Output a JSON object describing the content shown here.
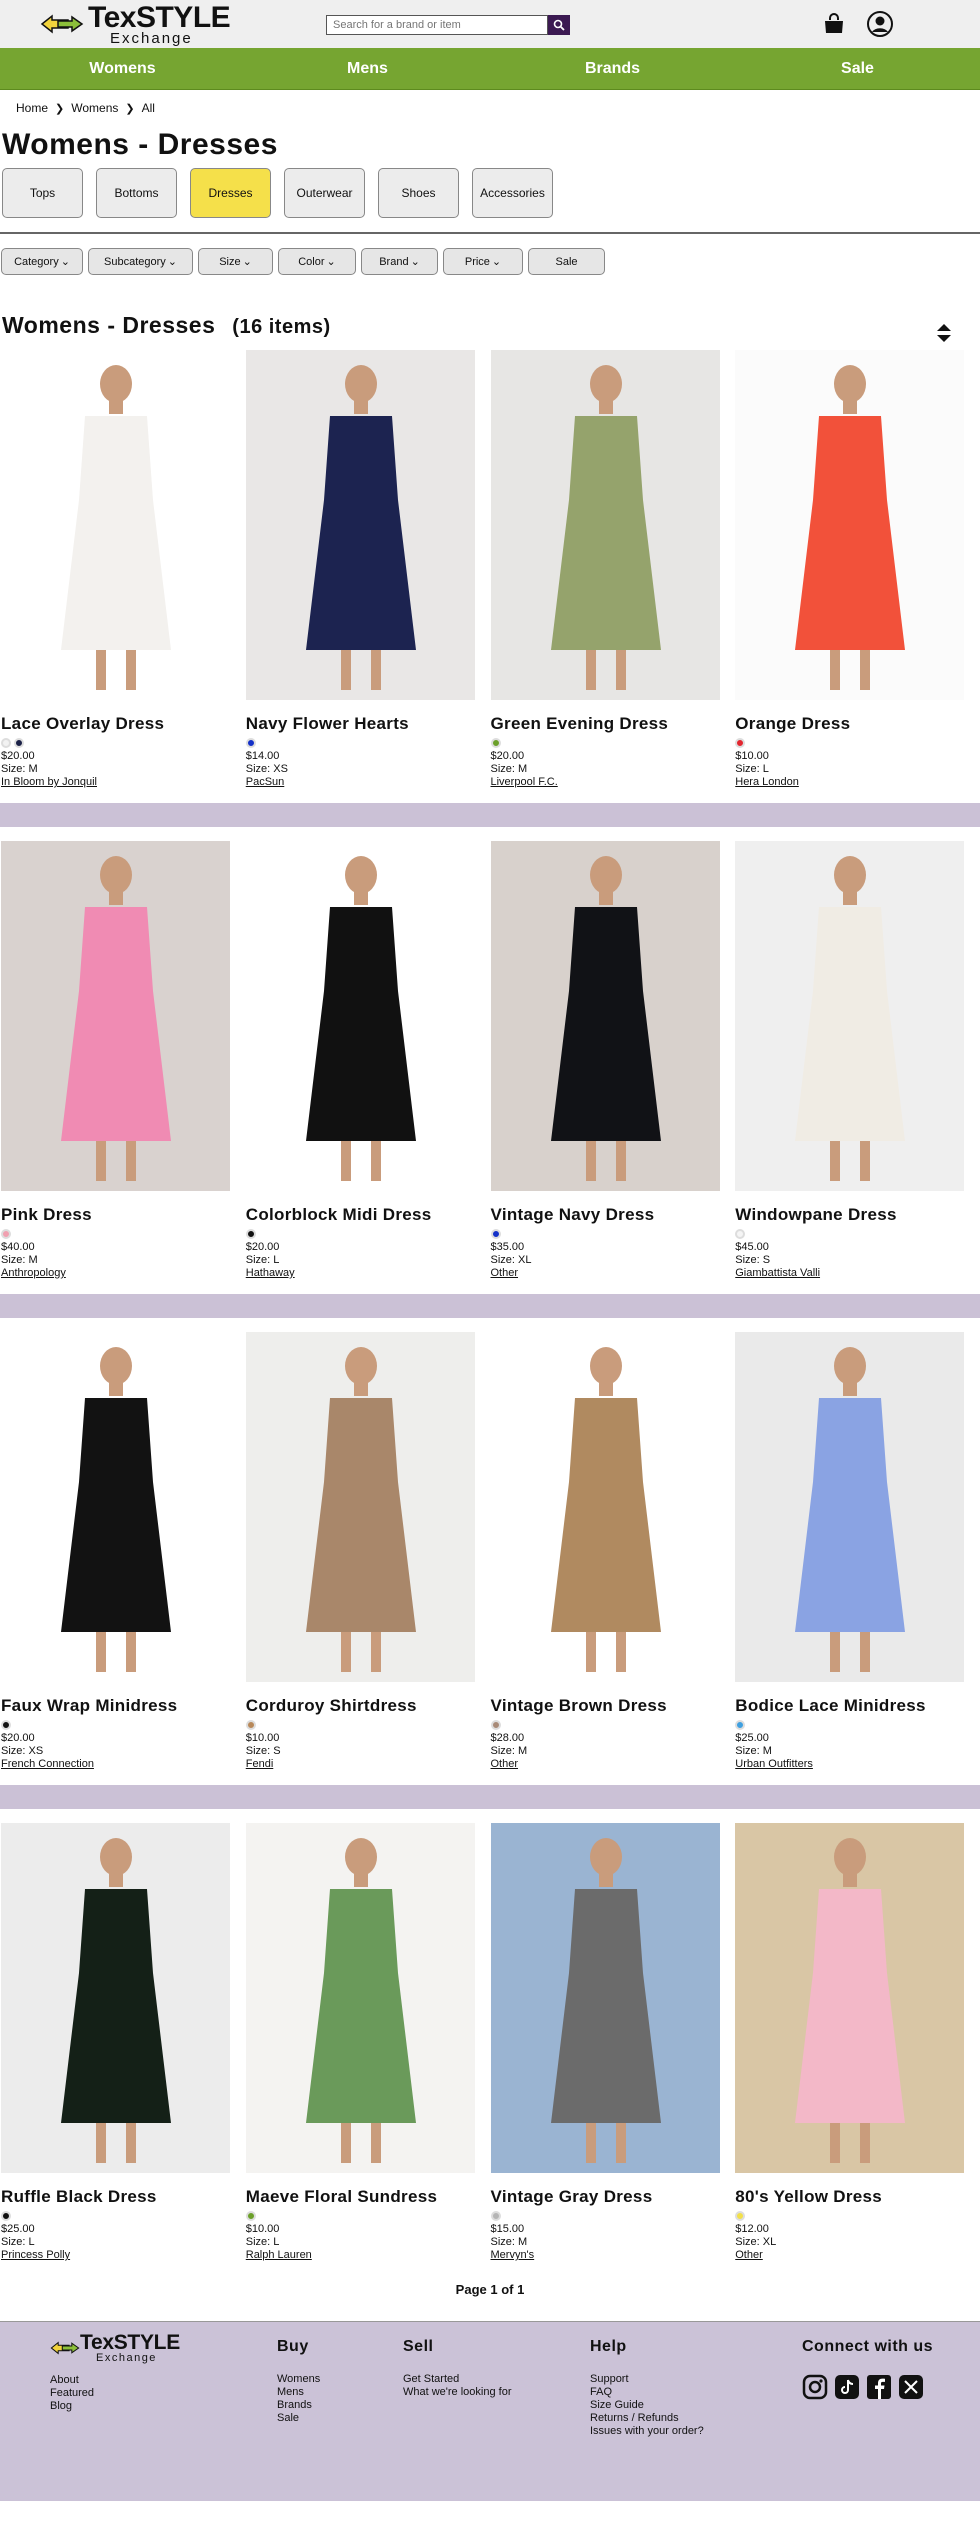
{
  "header": {
    "logo_line1": "TexSTYLE",
    "logo_line2": "Exchange",
    "search_placeholder": "Search for a brand or item"
  },
  "nav": [
    "Womens",
    "Mens",
    "Brands",
    "Sale"
  ],
  "breadcrumb": [
    "Home",
    "Womens",
    "All"
  ],
  "page_title": "Womens - Dresses",
  "categories": [
    "Tops",
    "Bottoms",
    "Dresses",
    "Outerwear",
    "Shoes",
    "Accessories"
  ],
  "active_category": "Dresses",
  "filters": [
    "Category",
    "Subcategory",
    "Size",
    "Color",
    "Brand",
    "Price",
    "Sale"
  ],
  "list": {
    "title": "Womens - Dresses",
    "count": "(16 items)"
  },
  "products": [
    {
      "name": "Lace Overlay Dress",
      "price": "$20.00",
      "size": "Size: M",
      "brand": "In Bloom by Jonquil",
      "swatches": [
        "#f2f2f2",
        "#1b2147"
      ],
      "image_colors": [
        "#ffffff",
        "#f3f1ee"
      ]
    },
    {
      "name": "Navy Flower Hearts",
      "price": "$14.00",
      "size": "Size: XS",
      "brand": "PacSun",
      "swatches": [
        "#1330c8"
      ],
      "image_colors": [
        "#e9e7e6",
        "#1c2350"
      ]
    },
    {
      "name": "Green Evening Dress",
      "price": "$20.00",
      "size": "Size: M",
      "brand": "Liverpool F.C.",
      "swatches": [
        "#6ca02a"
      ],
      "image_colors": [
        "#e7e6e4",
        "#95a36c"
      ]
    },
    {
      "name": "Orange Dress",
      "price": "$10.00",
      "size": "Size: L",
      "brand": "Hera London",
      "swatches": [
        "#e3262f"
      ],
      "image_colors": [
        "#fbfbfb",
        "#f2513a"
      ]
    },
    {
      "name": "Pink Dress",
      "price": "$40.00",
      "size": "Size: M",
      "brand": "Anthropology",
      "swatches": [
        "#f0a0b0"
      ],
      "image_colors": [
        "#d9d2cf",
        "#f08bb3"
      ]
    },
    {
      "name": "Colorblock Midi Dress",
      "price": "$20.00",
      "size": "Size: L",
      "brand": "Hathaway",
      "swatches": [
        "#111111"
      ],
      "image_colors": [
        "#ffffff",
        "#111111"
      ]
    },
    {
      "name": "Vintage Navy Dress",
      "price": "$35.00",
      "size": "Size: XL",
      "brand": "Other",
      "swatches": [
        "#1330c8"
      ],
      "image_colors": [
        "#d8d1cc",
        "#111216"
      ]
    },
    {
      "name": "Windowpane Dress",
      "price": "$45.00",
      "size": "Size: S",
      "brand": "Giambattista Valli",
      "swatches": [
        "#f5f5f5"
      ],
      "image_colors": [
        "#efefef",
        "#f0ece4"
      ]
    },
    {
      "name": "Faux Wrap Minidress",
      "price": "$20.00",
      "size": "Size: XS",
      "brand": "French Connection",
      "swatches": [
        "#111111"
      ],
      "image_colors": [
        "#ffffff",
        "#121212"
      ]
    },
    {
      "name": "Corduroy Shirtdress",
      "price": "$10.00",
      "size": "Size: S",
      "brand": "Fendi",
      "swatches": [
        "#b8895a"
      ],
      "image_colors": [
        "#eeeeec",
        "#a9876a"
      ]
    },
    {
      "name": "Vintage Brown Dress",
      "price": "$28.00",
      "size": "Size: M",
      "brand": "Other",
      "swatches": [
        "#a88a77"
      ],
      "image_colors": [
        "#ffffff",
        "#b08a60"
      ]
    },
    {
      "name": "Bodice Lace Minidress",
      "price": "$25.00",
      "size": "Size: M",
      "brand": "Urban Outfitters",
      "swatches": [
        "#3fa0e0"
      ],
      "image_colors": [
        "#eaeaea",
        "#8aa3e3"
      ]
    },
    {
      "name": "Ruffle Black Dress",
      "price": "$25.00",
      "size": "Size: L",
      "brand": "Princess Polly",
      "swatches": [
        "#111111"
      ],
      "image_colors": [
        "#ececec",
        "#142017"
      ]
    },
    {
      "name": "Maeve Floral Sundress",
      "price": "$10.00",
      "size": "Size: L",
      "brand": "Ralph Lauren",
      "swatches": [
        "#6ca02a"
      ],
      "image_colors": [
        "#f4f3f1",
        "#6a9a5a"
      ]
    },
    {
      "name": "Vintage Gray Dress",
      "price": "$15.00",
      "size": "Size: M",
      "brand": "Mervyn's",
      "swatches": [
        "#b5b5b5"
      ],
      "image_colors": [
        "#9ab4d2",
        "#6b6b6b"
      ]
    },
    {
      "name": "80's Yellow Dress",
      "price": "$12.00",
      "size": "Size: XL",
      "brand": "Other",
      "swatches": [
        "#f2e04a"
      ],
      "image_colors": [
        "#d9c6a5",
        "#f3b8c8"
      ]
    }
  ],
  "pagination": "Page 1 of 1",
  "footer": {
    "logo_line1": "TexSTYLE",
    "logo_line2": "Exchange",
    "about_links": [
      "About",
      "Featured",
      "Blog"
    ],
    "buy": {
      "title": "Buy",
      "links": [
        "Womens",
        "Mens",
        "Brands",
        "Sale"
      ]
    },
    "sell": {
      "title": "Sell",
      "links": [
        "Get Started",
        "What we're looking for"
      ]
    },
    "help": {
      "title": "Help",
      "links": [
        "Support",
        "FAQ",
        "Size Guide",
        "Returns / Refunds",
        "Issues with your order?"
      ]
    },
    "connect": {
      "title": "Connect with us",
      "icons": [
        "instagram-icon",
        "tiktok-icon",
        "facebook-icon",
        "x-icon"
      ]
    }
  },
  "colors": {
    "nav_green": "#76a531",
    "active_category": "#f5e04a",
    "row_separator": "#cbc1d6",
    "footer_bg": "#cbc2d7",
    "search_button": "#3c1a52"
  }
}
